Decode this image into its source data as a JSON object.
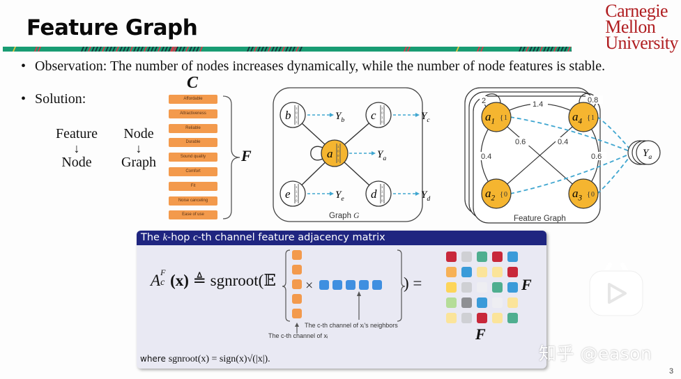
{
  "slide": {
    "title": "Feature Graph",
    "logo": [
      "Carnegie",
      "Mellon",
      "University"
    ],
    "page_number": "3",
    "watermark": "知乎 @eason"
  },
  "bullets": {
    "observation": "Observation:  The number of nodes increases dynamically, while the number of node features is stable.",
    "solution": "Solution:",
    "bullet_glyph": "•"
  },
  "flow": {
    "left": {
      "from": "Feature",
      "to": "Node"
    },
    "right": {
      "from": "Node",
      "to": "Graph"
    },
    "arrow": "↓"
  },
  "feature_list": {
    "channel_label": "C",
    "group_label": "F",
    "items": [
      "Affordable",
      "Attractiveness",
      "Reliable",
      "Durable",
      "Sound quality",
      "Comfort",
      "Fit",
      "Noise canceling",
      "Ease of use"
    ],
    "chip_color": "#f39a4c"
  },
  "graph_g": {
    "caption": "Graph",
    "caption_symbol": "G",
    "center_node": "a",
    "nodes": [
      {
        "id": "b",
        "label": "Y",
        "sub": "b",
        "bits": [
          "1",
          "0",
          "1",
          "1"
        ]
      },
      {
        "id": "c",
        "label": "Y",
        "sub": "c",
        "bits": [
          "1",
          "0",
          "1",
          "0"
        ]
      },
      {
        "id": "a",
        "label": "Y",
        "sub": "a",
        "bits": [
          "1",
          "0",
          "0",
          "1"
        ]
      },
      {
        "id": "e",
        "label": "Y",
        "sub": "e",
        "bits": [
          "1",
          "1",
          "1",
          "0"
        ]
      },
      {
        "id": "d",
        "label": "Y",
        "sub": "d",
        "bits": [
          "1",
          "1",
          "0",
          "0"
        ]
      }
    ],
    "highlight_color": "#f5b530",
    "arrow_color": "#3fa6d0"
  },
  "feature_graph": {
    "caption": "Feature Graph",
    "nodes": [
      {
        "id": "a1",
        "base": "a",
        "sub": "1",
        "bit": "1"
      },
      {
        "id": "a4",
        "base": "a",
        "sub": "4",
        "bit": "1"
      },
      {
        "id": "a2",
        "base": "a",
        "sub": "2",
        "bit": "0"
      },
      {
        "id": "a3",
        "base": "a",
        "sub": "3",
        "bit": "0"
      }
    ],
    "edges": [
      {
        "from": "a1",
        "to": "a1",
        "weight": "2"
      },
      {
        "from": "a1",
        "to": "a4",
        "weight": "1.4"
      },
      {
        "from": "a4",
        "to": "a4",
        "weight": "0.8"
      },
      {
        "from": "a1",
        "to": "a3",
        "weight": "0.6"
      },
      {
        "from": "a4",
        "to": "a2",
        "weight": "0.4"
      },
      {
        "from": "a1",
        "to": "a2",
        "weight": "0.4"
      },
      {
        "from": "a4",
        "to": "a3",
        "weight": "0.6"
      }
    ],
    "target": {
      "label": "Y",
      "sub": "a"
    }
  },
  "definition_box": {
    "header_pre": "The ",
    "header_k": "k",
    "header_mid": "-hop ",
    "header_c": "c",
    "header_post": "-th channel feature adjacency matrix",
    "formula_lhs": "A",
    "formula_sup": "F",
    "formula_sub": "c",
    "formula_arg": "(x)",
    "formula_def": "≜",
    "formula_fn": "sgnroot(",
    "formula_expect": "𝔼",
    "times": "×",
    "close": ") =",
    "neighbors_note": "The c-th channel of xᵢ's neighbors",
    "self_note": "The c-th channel of xᵢ",
    "where_prefix": "where",
    "where_formula": "sgnroot(x) = sign(x)√(|x|).",
    "orange": "#f39a4c",
    "blue": "#3f8fe0",
    "matrix_row_label": "F",
    "matrix_col_label": "F",
    "matrix_colors": [
      [
        "#c8283a",
        "#cfd0d4",
        "#4fae8f",
        "#c8283a",
        "#3a9bd9"
      ],
      [
        "#f7b156",
        "#3a9bd9",
        "#fbe49a",
        "#fbe49a",
        "#c8283a"
      ],
      [
        "#fdd55a",
        "#cfd0d4",
        "#eeeef2",
        "#4fae8f",
        "#3a9bd9"
      ],
      [
        "#b5dd98",
        "#8e8f93",
        "#3a9bd9",
        "#eeeef2",
        "#fbe49a"
      ],
      [
        "#fbe49a",
        "#cfd0d4",
        "#c8283a",
        "#fbe49a",
        "#4fae8f"
      ]
    ]
  },
  "theme": {
    "band_green": "#199c73",
    "band_dark": "#17343a",
    "band_red": "#d23a4a",
    "header_navy": "#1f2580",
    "cmu_red": "#b01d20"
  }
}
